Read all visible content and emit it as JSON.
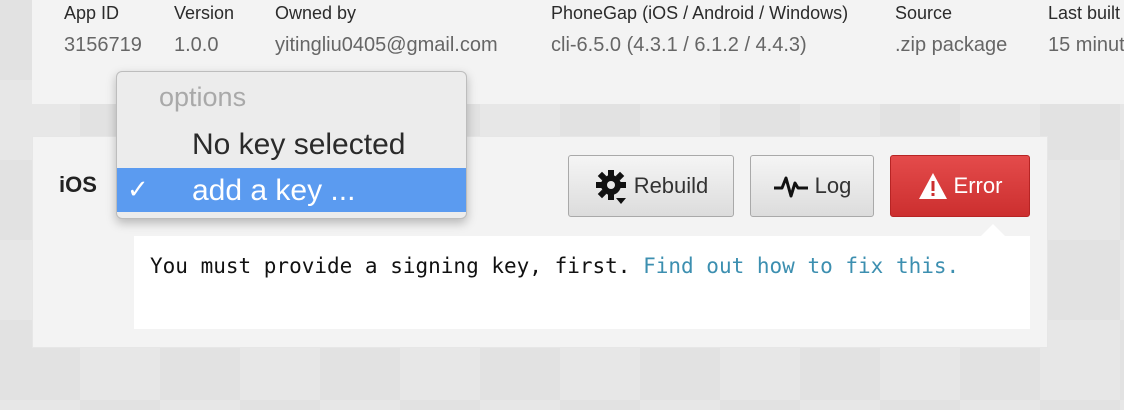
{
  "app_info": {
    "columns": [
      {
        "label": "App ID",
        "value": "3156719"
      },
      {
        "label": "Version",
        "value": "1.0.0"
      },
      {
        "label": "Owned by",
        "value": "yitingliu0405@gmail.com"
      },
      {
        "label": "PhoneGap (iOS / Android / Windows)",
        "value": "cli-6.5.0 (4.3.1 / 6.1.2 / 4.4.3)"
      },
      {
        "label": "Source",
        "value": ".zip package"
      },
      {
        "label": "Last built",
        "value": "15 minut"
      }
    ]
  },
  "platform": {
    "name": "iOS",
    "buttons": {
      "rebuild_label": "Rebuild",
      "log_label": "Log",
      "error_label": "Error"
    },
    "message": {
      "text": "You must provide a signing key, first.",
      "link_text": "Find out how to fix this."
    }
  },
  "key_dropdown": {
    "header": "options",
    "items": [
      {
        "label": "No key selected",
        "selected": false
      },
      {
        "label": "add a key ...",
        "selected": true
      }
    ],
    "check_glyph": "✓"
  },
  "colors": {
    "error_red": "#cc2f2f",
    "highlight_blue": "#5b9bf0",
    "link_teal": "#3c8fb0"
  },
  "icons": {
    "rebuild": "gear-refresh-icon",
    "log": "pulse-icon",
    "error": "warning-triangle-icon"
  }
}
